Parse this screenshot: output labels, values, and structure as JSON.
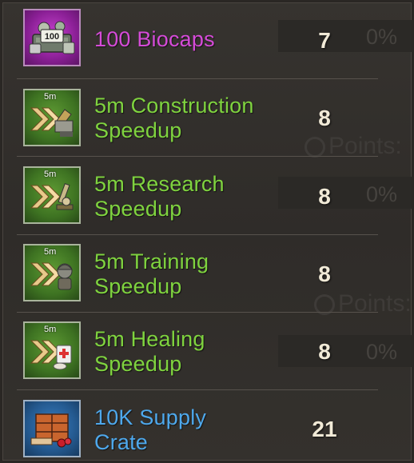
{
  "background": {
    "points_label": "Points:",
    "percent_label": "0%"
  },
  "items": [
    {
      "name": "100 Biocaps",
      "quantity": "7",
      "badge": "",
      "icon_label": "100",
      "rarity": "purple",
      "rarity_color": "#d54bd8"
    },
    {
      "name_line1": "5m Construction",
      "name_line2": "Speedup",
      "quantity": "8",
      "badge": "5m",
      "rarity": "green",
      "rarity_color": "#7fd33f"
    },
    {
      "name_line1": "5m Research",
      "name_line2": "Speedup",
      "quantity": "8",
      "badge": "5m",
      "rarity": "green",
      "rarity_color": "#7fd33f"
    },
    {
      "name_line1": "5m Training",
      "name_line2": "Speedup",
      "quantity": "8",
      "badge": "5m",
      "rarity": "green",
      "rarity_color": "#7fd33f"
    },
    {
      "name_line1": "5m Healing",
      "name_line2": "Speedup",
      "quantity": "8",
      "badge": "5m",
      "rarity": "green",
      "rarity_color": "#7fd33f"
    },
    {
      "name_line1": "10K Supply",
      "name_line2": "Crate",
      "quantity": "21",
      "badge": "",
      "rarity": "blue",
      "rarity_color": "#4ea8ec"
    }
  ]
}
